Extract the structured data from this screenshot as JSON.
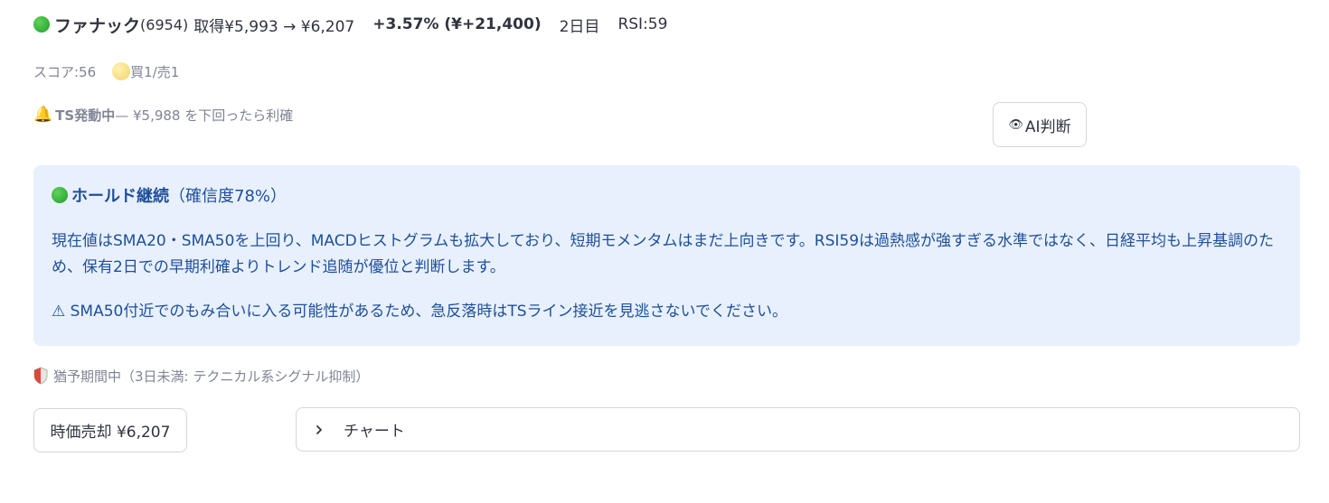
{
  "position": {
    "name": "ファナック",
    "code": "(6954)",
    "price_text": "取得¥5,993 → ¥6,207",
    "pl_text": "+3.57% (¥+21,400)",
    "days_text": "2日目",
    "rsi_text": "RSI:59"
  },
  "score": {
    "label": "スコア:56",
    "signals": "買1/売1"
  },
  "trailing_stop": {
    "title": "TS発動中",
    "detail": " — ¥5,988 を下回ったら利確"
  },
  "ai_button": {
    "icon": "👁",
    "label": "AI判断"
  },
  "ai_result": {
    "verdict": "ホールド継続",
    "confidence": "（確信度78%）",
    "body": "現在値はSMA20・SMA50を上回り、MACDヒストグラムも拡大しており、短期モメンタムはまだ上向きです。RSI59は過熱感が強すぎる水準ではなく、日経平均も上昇基調のため、保有2日での早期利確よりトレンド追随が優位と判断します。",
    "warning": "⚠ SMA50付近でのもみ合いに入る可能性があるため、急反落時はTSライン接近を見逃さないでください。"
  },
  "grace": {
    "text": "猶予期間中（3日未満: テクニカル系シグナル抑制）"
  },
  "sell_button": {
    "label": "時価売却 ¥6,207"
  },
  "chart_expander": {
    "label": "チャート"
  },
  "colors": {
    "accent_blue": "#1e4f9a",
    "info_background": "#e8f0fd",
    "muted_text": "#808495",
    "status_green": "#21a33a"
  }
}
